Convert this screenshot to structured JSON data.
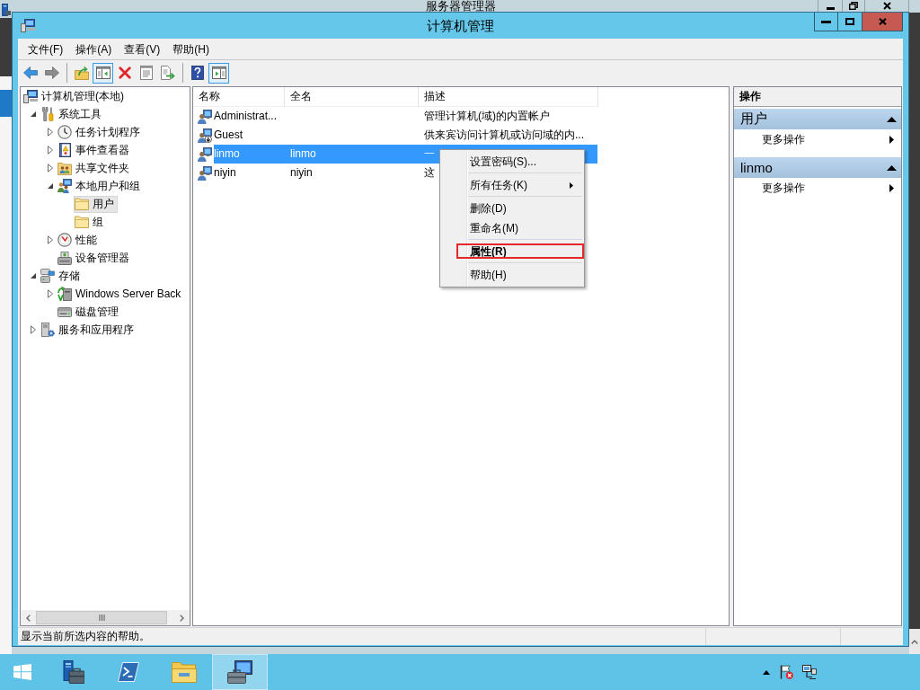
{
  "background_window": {
    "title": "服务器管理器"
  },
  "window": {
    "title": "计算机管理"
  },
  "menu_bar": [
    "文件(F)",
    "操作(A)",
    "查看(V)",
    "帮助(H)"
  ],
  "toolbar": [
    {
      "kind": "button",
      "disabled": false,
      "pressed": false
    },
    {
      "kind": "button",
      "disabled": true,
      "pressed": false
    },
    {
      "kind": "separator"
    },
    {
      "kind": "button",
      "disabled": false,
      "pressed": false
    },
    {
      "kind": "button",
      "disabled": false,
      "pressed": true
    },
    {
      "kind": "button",
      "disabled": false,
      "pressed": false
    },
    {
      "kind": "button",
      "disabled": false,
      "pressed": false
    },
    {
      "kind": "button",
      "disabled": false,
      "pressed": false
    },
    {
      "kind": "separator"
    },
    {
      "kind": "button",
      "disabled": false,
      "pressed": false
    },
    {
      "kind": "button",
      "disabled": false,
      "pressed": true
    }
  ],
  "tree": {
    "label": "计算机管理(本地)",
    "expandable": false,
    "selected": false,
    "children": [
      {
        "label": "系统工具",
        "expandable": true,
        "expanded": true,
        "selected": false,
        "children": [
          {
            "label": "任务计划程序",
            "expandable": true,
            "expanded": false,
            "selected": false
          },
          {
            "label": "事件查看器",
            "expandable": true,
            "expanded": false,
            "selected": false
          },
          {
            "label": "共享文件夹",
            "expandable": true,
            "expanded": false,
            "selected": false
          },
          {
            "label": "本地用户和组",
            "expandable": true,
            "expanded": true,
            "selected": false,
            "children": [
              {
                "label": "用户",
                "expandable": false,
                "selected": true
              },
              {
                "label": "组",
                "expandable": false,
                "selected": false
              }
            ]
          },
          {
            "label": "性能",
            "expandable": true,
            "expanded": false,
            "selected": false
          },
          {
            "label": "设备管理器",
            "expandable": false,
            "selected": false
          }
        ]
      },
      {
        "label": "存储",
        "expandable": true,
        "expanded": true,
        "selected": false,
        "children": [
          {
            "label": "Windows Server Back",
            "expandable": true,
            "expanded": false,
            "selected": false
          },
          {
            "label": "磁盘管理",
            "expandable": false,
            "selected": false
          }
        ]
      },
      {
        "label": "服务和应用程序",
        "expandable": true,
        "expanded": false,
        "selected": false
      }
    ]
  },
  "list": {
    "columns": [
      "名称",
      "全名",
      "描述"
    ],
    "rows": [
      {
        "name": "Administrat...",
        "description": "管理计算机(域)的内置帐户",
        "disabled": false,
        "selected": false
      },
      {
        "name": "Guest",
        "description": "供来宾访问计算机或访问域的内...",
        "disabled": true,
        "selected": false
      },
      {
        "name": "linmo",
        "full_name": "linmo",
        "description": "一",
        "disabled": false,
        "selected": true
      },
      {
        "name": "niyin",
        "full_name": "niyin",
        "description": "这",
        "disabled": false,
        "selected": false
      }
    ]
  },
  "context_menu": {
    "items": [
      {
        "kind": "item",
        "label": "设置密码(S)...",
        "has_submenu": false,
        "default": false,
        "outlined": false
      },
      {
        "kind": "separator"
      },
      {
        "kind": "item",
        "label": "所有任务(K)",
        "has_submenu": true,
        "default": false,
        "outlined": false
      },
      {
        "kind": "separator"
      },
      {
        "kind": "item",
        "label": "删除(D)",
        "has_submenu": false,
        "default": false,
        "outlined": false
      },
      {
        "kind": "item",
        "label": "重命名(M)",
        "has_submenu": false,
        "default": false,
        "outlined": false
      },
      {
        "kind": "separator"
      },
      {
        "kind": "item",
        "label": "属性(R)",
        "has_submenu": false,
        "default": true,
        "outlined": true
      },
      {
        "kind": "separator"
      },
      {
        "kind": "item",
        "label": "帮助(H)",
        "has_submenu": false,
        "default": false,
        "outlined": false
      }
    ]
  },
  "action_pane": {
    "title": "操作",
    "sections": [
      {
        "title": "用户",
        "expanded": true,
        "items": [
          "更多操作"
        ]
      },
      {
        "title": "linmo",
        "expanded": true,
        "items": [
          "更多操作"
        ]
      }
    ]
  },
  "status_bar": {
    "text": "显示当前所选内容的帮助。"
  },
  "taskbar": {
    "apps": [
      {
        "selected": false
      },
      {
        "selected": false
      },
      {
        "selected": false
      },
      {
        "selected": true
      }
    ]
  }
}
